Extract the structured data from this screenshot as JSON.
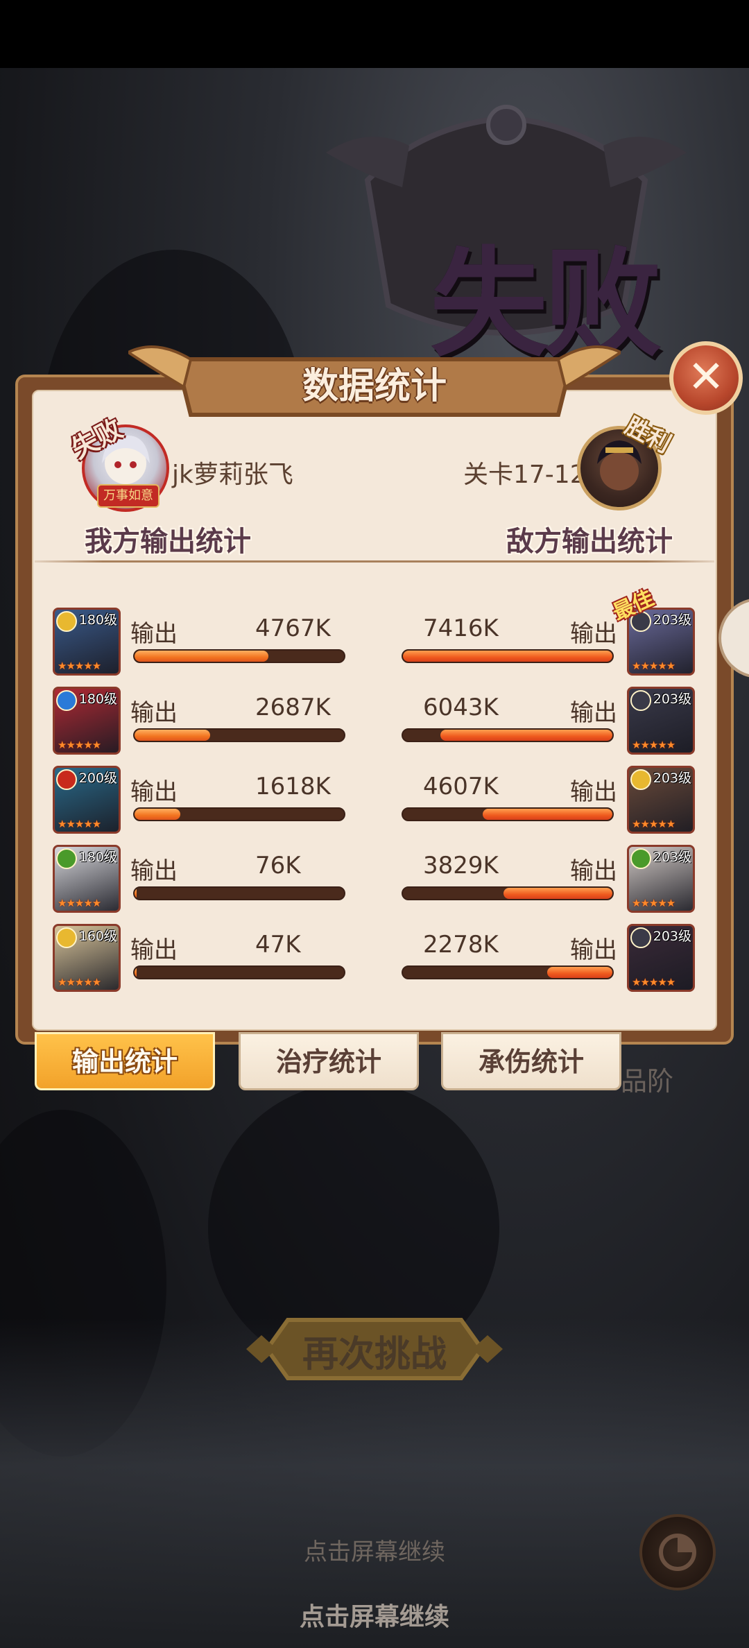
{
  "result_title": "失败",
  "panel": {
    "title": "数据统计",
    "close_glyph": "✕",
    "player_name": "jk萝莉张飞",
    "stage_name": "关卡17-12",
    "player_badge": "失败",
    "enemy_badge": "胜利",
    "fortune_tag": "万事如意",
    "left_heading": "我方输出统计",
    "right_heading": "敌方输出统计",
    "best_tag": "最佳",
    "colors": {
      "player_fill": "#f27420",
      "enemy_fill": "#ef5a1e",
      "bar_track": "#4a2a1c"
    }
  },
  "allies": [
    {
      "level": "180级",
      "stat_label": "输出",
      "value": "4767K",
      "fill": 0.64,
      "element": "gold-icon"
    },
    {
      "level": "180级",
      "stat_label": "输出",
      "value": "2687K",
      "fill": 0.36,
      "element": "water-icon"
    },
    {
      "level": "200级",
      "stat_label": "输出",
      "value": "1618K",
      "fill": 0.22,
      "element": "fire-icon"
    },
    {
      "level": "180级",
      "stat_label": "输出",
      "value": "76K",
      "fill": 0.01,
      "element": "wind-icon"
    },
    {
      "level": "160级",
      "stat_label": "输出",
      "value": "47K",
      "fill": 0.01,
      "element": "gold-icon"
    }
  ],
  "enemies": [
    {
      "level": "203级",
      "stat_label": "输出",
      "value": "7416K",
      "fill": 1.0,
      "element": "dark-icon"
    },
    {
      "level": "203级",
      "stat_label": "输出",
      "value": "6043K",
      "fill": 0.82,
      "element": "dark-icon"
    },
    {
      "level": "203级",
      "stat_label": "输出",
      "value": "4607K",
      "fill": 0.62,
      "element": "gold-icon"
    },
    {
      "level": "203级",
      "stat_label": "输出",
      "value": "3829K",
      "fill": 0.52,
      "element": "wind-icon"
    },
    {
      "level": "203级",
      "stat_label": "输出",
      "value": "2278K",
      "fill": 0.31,
      "element": "dark-icon"
    }
  ],
  "stars": "★★★★★",
  "tabs": [
    {
      "label": "输出统计",
      "active": true
    },
    {
      "label": "治疗统计",
      "active": false
    },
    {
      "label": "承伤统计",
      "active": false
    }
  ],
  "background": {
    "quality_hint": "品阶",
    "retry_label": "再次挑战",
    "tap_hint_dim": "点击屏幕继续",
    "tap_hint": "点击屏幕继续"
  }
}
